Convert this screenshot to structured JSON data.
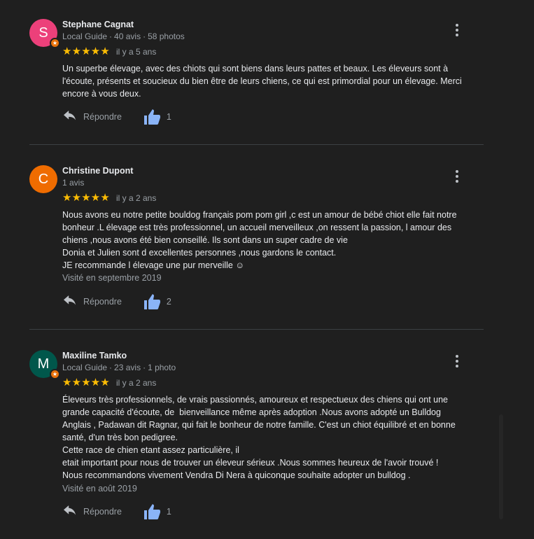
{
  "reviews": [
    {
      "avatar_letter": "S",
      "avatar_color": "#ec407a",
      "local_guide": true,
      "name": "Stephane Cagnat",
      "meta": [
        "Local Guide",
        "40 avis",
        "58 photos"
      ],
      "rating": 5,
      "date": "il y a 5 ans",
      "text": [
        "Un superbe élevage, avec des chiots qui sont biens dans leurs pattes et beaux. Les éleveurs sont à",
        "l'écoute, présents et soucieux du bien être de leurs chiens, ce qui est primordial pour un élevage. Merci",
        "encore à vous deux."
      ],
      "visited": "",
      "reply_label": "Répondre",
      "likes": "1"
    },
    {
      "avatar_letter": "C",
      "avatar_color": "#ef6c00",
      "local_guide": false,
      "name": "Christine Dupont",
      "meta": [
        "1 avis"
      ],
      "rating": 5,
      "date": "il y a 2 ans",
      "text": [
        "Nous avons eu notre petite bouldog français pom pom girl ,c est un amour de bébé chiot elle fait notre",
        "bonheur .L élevage est très professionnel, un accueil merveilleux ,on ressent la passion, l amour des",
        "chiens ,nous avons été bien conseillé. Ils sont dans un super cadre de vie",
        "Donia et Julien sont d excellentes personnes ,nous gardons le contact.",
        "JE recommande l élevage une pur merveille ☺"
      ],
      "visited": "Visité en septembre 2019",
      "reply_label": "Répondre",
      "likes": "2"
    },
    {
      "avatar_letter": "M",
      "avatar_color": "#00574b",
      "local_guide": true,
      "name": "Maxiline Tamko",
      "meta": [
        "Local Guide",
        "23 avis",
        "1 photo"
      ],
      "rating": 5,
      "date": "il y a 2 ans",
      "text": [
        "Éleveurs très professionnels, de vrais passionnés, amoureux et respectueux des chiens qui ont une",
        "grande capacité d'écoute, de  bienveillance même après adoption .Nous avons adopté un Bulldog",
        "Anglais , Padawan dit Ragnar, qui fait le bonheur de notre famille. C'est un chiot équilibré et en bonne",
        "santé, d'un très bon pedigree.",
        "Cette race de chien etant assez particulière, il",
        "etait important pour nous de trouver un éleveur sérieux .Nous sommes heureux de l'avoir trouvé !",
        "Nous recommandons vivement Vendra Di Nera à quiconque souhaite adopter un bulldog ."
      ],
      "visited": "Visité en août 2019",
      "reply_label": "Répondre",
      "likes": "1"
    }
  ],
  "colors": {
    "star": "#fbbc04",
    "like": "#8ab4f8",
    "background": "#1f1f1f"
  },
  "icons": {
    "reply": "reply-arrow-icon",
    "like": "thumbs-up-icon",
    "menu": "more-vert-icon",
    "badge": "local-guide-star-icon"
  }
}
